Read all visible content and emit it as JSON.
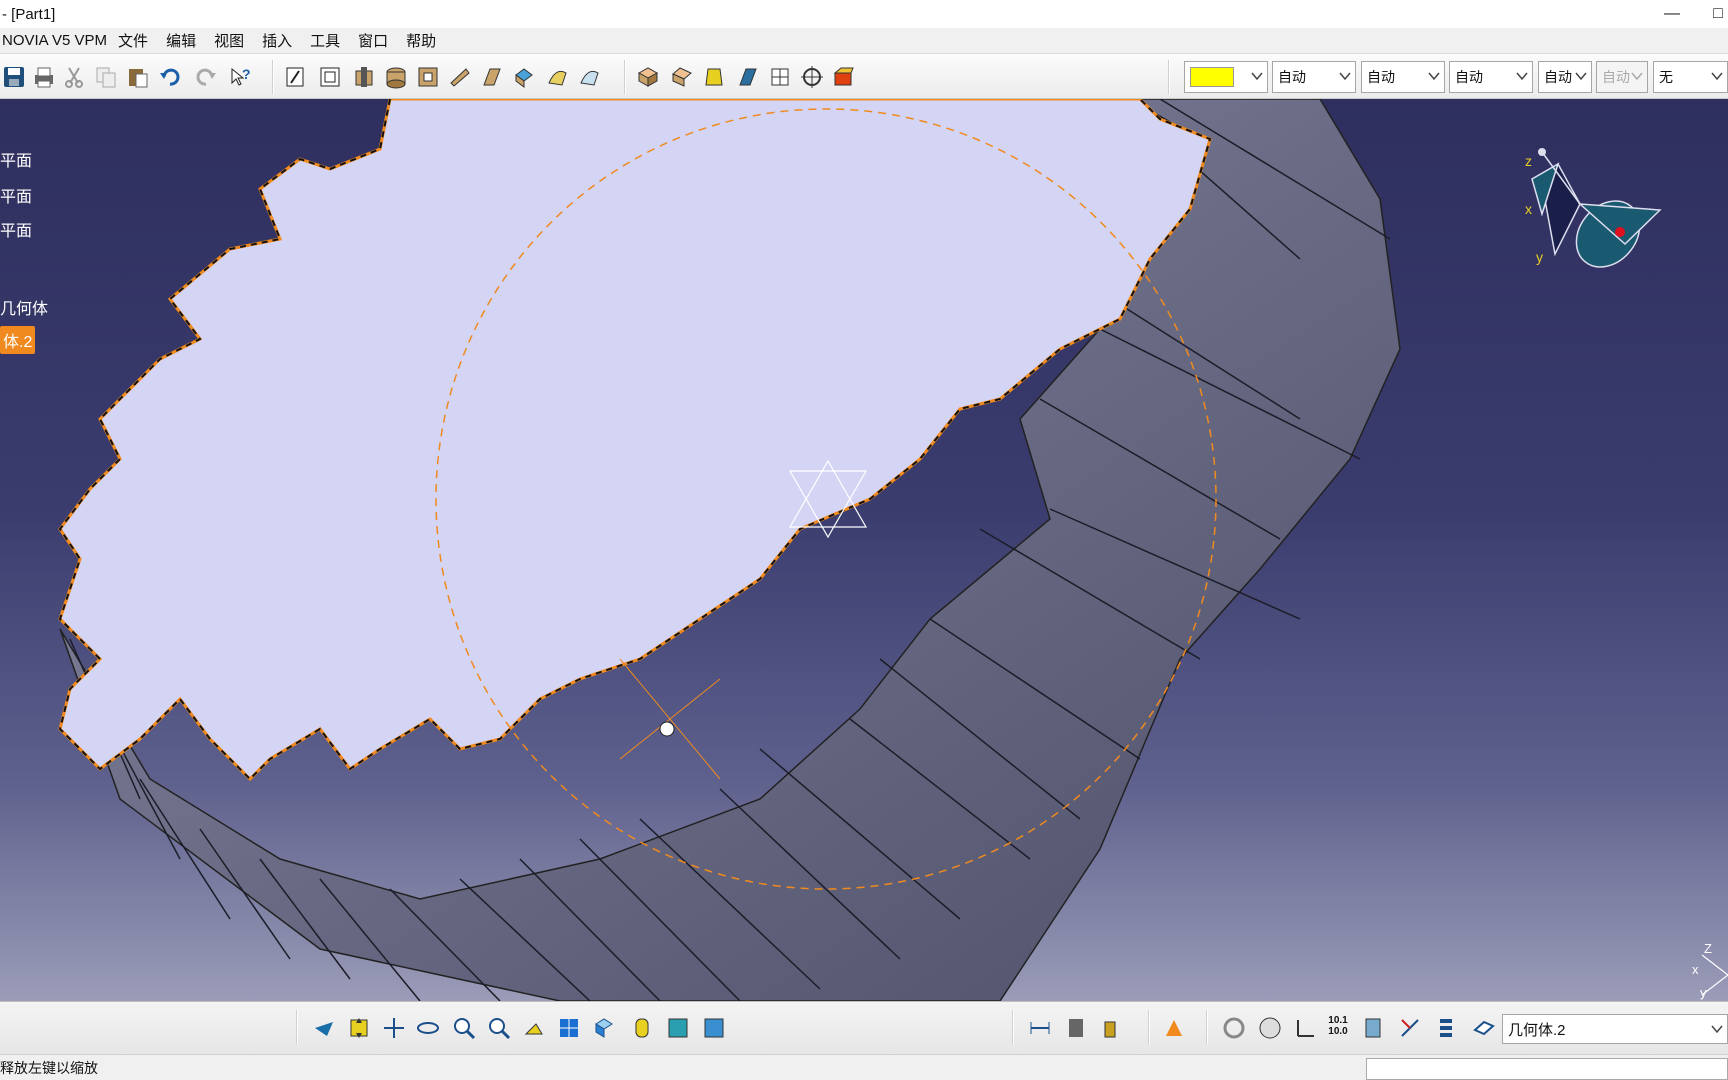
{
  "window": {
    "title": "- [Part1]",
    "minimize_icon": "minimize-icon",
    "maximize_icon": "maximize-icon"
  },
  "menubar": {
    "app_label": "NOVIA V5 VPM",
    "items": [
      "文件",
      "编辑",
      "视图",
      "插入",
      "工具",
      "窗口",
      "帮助"
    ]
  },
  "toolbar": {
    "icons": [
      "save-icon",
      "print-icon",
      "cut-icon",
      "copy-icon",
      "paste-icon",
      "undo-icon",
      "redo-icon",
      "whats-this-icon",
      "sketch-icon",
      "positioned-sketch-icon",
      "pad-icon",
      "pocket-icon",
      "shaft-icon",
      "groove-icon",
      "rib-icon",
      "slot-icon",
      "multi-section-icon",
      "removed-multi-section-icon",
      "fillet-icon",
      "chamfer-icon",
      "draft-icon",
      "shell-icon",
      "thickness-icon",
      "thread-icon",
      "hole-icon",
      "body-icon"
    ],
    "graphic_properties": {
      "fill_color": "#ffff00",
      "transparency": "自动",
      "line_thickness": "自动",
      "line_type": "自动",
      "point_type": "自动",
      "layer_disabled": "自动",
      "render_style": "无"
    }
  },
  "tree": {
    "items": [
      {
        "label": "平面"
      },
      {
        "label": "平面"
      },
      {
        "label": "平面"
      },
      {
        "label": "几何体"
      },
      {
        "label": "体.2",
        "selected": true
      }
    ]
  },
  "compass": {
    "z": "z",
    "x": "x",
    "y": "y"
  },
  "mini_axis": {
    "z": "Z",
    "x": "x",
    "y": "y"
  },
  "colors": {
    "viewport_top": "#2e2f5e",
    "viewport_bottom": "#9a9cb8",
    "gear_face": "#d4d4f4",
    "gear_side": "#6b6d88",
    "highlight": "#f08a1e"
  },
  "bottom_toolbar": {
    "icons": [
      "fly-mode-icon",
      "fit-all-icon",
      "pan-icon",
      "rotate-icon",
      "zoom-in-icon",
      "zoom-out-icon",
      "normal-view-icon",
      "multi-view-icon",
      "iso-view-icon",
      "shading-icon",
      "hide-show-icon",
      "swap-visible-icon",
      "measure-icon",
      "apply-material-icon",
      "mass-icon",
      "catalog-icon",
      "update-icon",
      "manipulate-icon",
      "axis-system-icon",
      "units-icon",
      "geometry-icon",
      "scan-icon",
      "stack-icon",
      "layer-icon"
    ],
    "units_label": "10.1\n10.0",
    "current_body": "几何体.2"
  },
  "statusbar": {
    "message": "释放左键以缩放"
  }
}
